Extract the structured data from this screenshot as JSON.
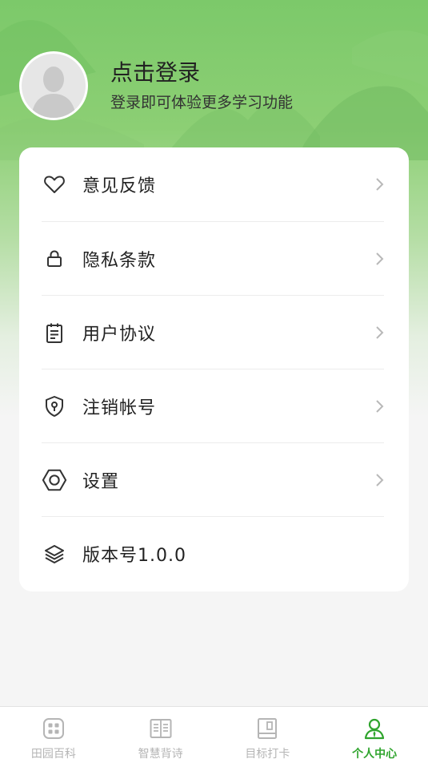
{
  "profile": {
    "title": "点击登录",
    "subtitle": "登录即可体验更多学习功能"
  },
  "menu": [
    {
      "label": "意见反馈",
      "icon": "heart-icon"
    },
    {
      "label": "隐私条款",
      "icon": "lock-icon"
    },
    {
      "label": "用户协议",
      "icon": "clipboard-icon"
    },
    {
      "label": "注销帐号",
      "icon": "shield-key-icon"
    },
    {
      "label": "设置",
      "icon": "hexagon-settings-icon"
    },
    {
      "label": "版本号1.0.0",
      "icon": "layers-icon"
    }
  ],
  "tabbar": [
    {
      "label": "田园百科",
      "icon": "grid-icon",
      "active": false
    },
    {
      "label": "智慧背诗",
      "icon": "book-open-icon",
      "active": false
    },
    {
      "label": "目标打卡",
      "icon": "notebook-icon",
      "active": false
    },
    {
      "label": "个人中心",
      "icon": "user-icon",
      "active": true
    }
  ],
  "colors": {
    "accent": "#2fa42d",
    "header_green": "#7cc96a",
    "background": "#f5f5f5"
  }
}
